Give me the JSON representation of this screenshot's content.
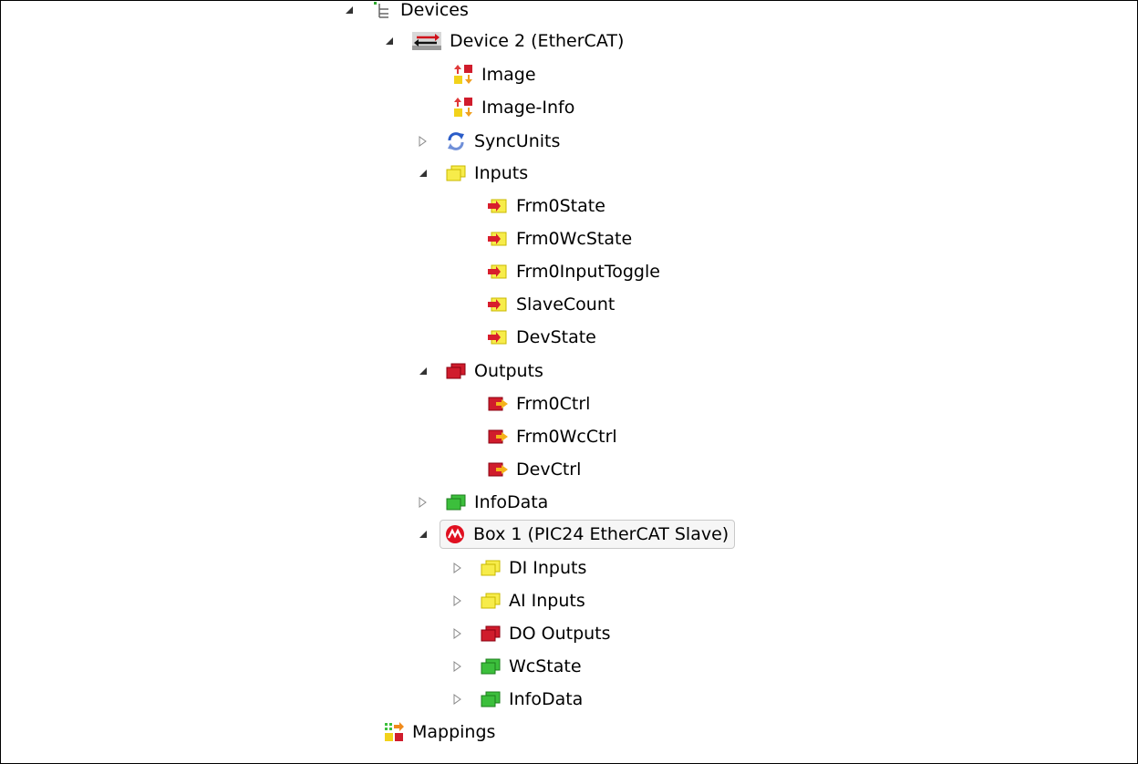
{
  "tree": {
    "devices": {
      "label": "Devices",
      "icon": "device-tree-icon",
      "expanded": true
    },
    "device2": {
      "label": "Device 2 (EtherCAT)",
      "icon": "ethercat-device-icon",
      "expanded": true
    },
    "image": {
      "label": "Image",
      "icon": "image-icon"
    },
    "image_info": {
      "label": "Image-Info",
      "icon": "image-info-icon"
    },
    "sync_units": {
      "label": "SyncUnits",
      "icon": "sync-units-icon",
      "expanded": false
    },
    "inputs": {
      "label": "Inputs",
      "icon": "inputs-folder-icon",
      "expanded": true,
      "items": [
        {
          "label": "Frm0State",
          "icon": "input-variable-icon"
        },
        {
          "label": "Frm0WcState",
          "icon": "input-variable-icon"
        },
        {
          "label": "Frm0InputToggle",
          "icon": "input-variable-icon"
        },
        {
          "label": "SlaveCount",
          "icon": "input-variable-icon"
        },
        {
          "label": "DevState",
          "icon": "input-variable-icon"
        }
      ]
    },
    "outputs": {
      "label": "Outputs",
      "icon": "outputs-folder-icon",
      "expanded": true,
      "items": [
        {
          "label": "Frm0Ctrl",
          "icon": "output-variable-icon"
        },
        {
          "label": "Frm0WcCtrl",
          "icon": "output-variable-icon"
        },
        {
          "label": "DevCtrl",
          "icon": "output-variable-icon"
        }
      ]
    },
    "info_data": {
      "label": "InfoData",
      "icon": "infodata-folder-icon",
      "expanded": false
    },
    "box1": {
      "label": "Box 1 (PIC24 EtherCAT Slave)",
      "icon": "microchip-box-icon",
      "expanded": true,
      "selected": true,
      "items": [
        {
          "label": "DI Inputs",
          "icon": "inputs-folder-icon"
        },
        {
          "label": "AI Inputs",
          "icon": "inputs-folder-icon"
        },
        {
          "label": "DO Outputs",
          "icon": "outputs-folder-icon"
        },
        {
          "label": "WcState",
          "icon": "infodata-folder-icon"
        },
        {
          "label": "InfoData",
          "icon": "infodata-folder-icon"
        }
      ]
    },
    "mappings": {
      "label": "Mappings",
      "icon": "mappings-icon"
    }
  },
  "colors": {
    "input_yellow": "#f2e21a",
    "output_red": "#c8102e",
    "info_green": "#2eaa2e",
    "selection_border": "#c9c9c9"
  }
}
